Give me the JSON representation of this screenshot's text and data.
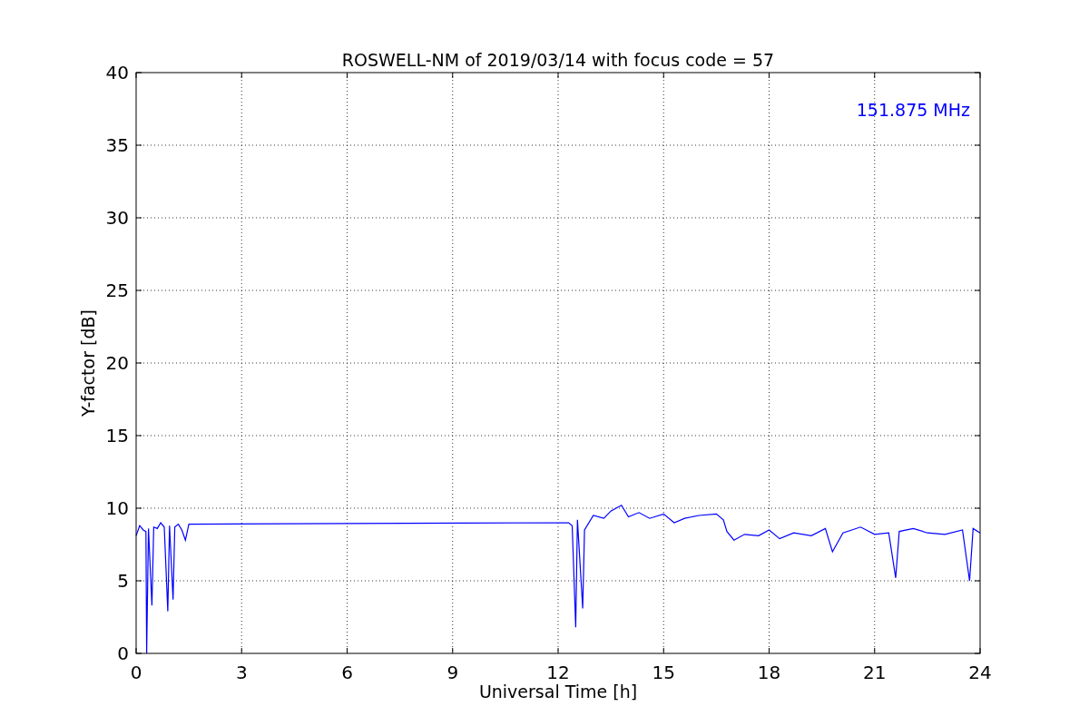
{
  "chart": {
    "chart_data": {
      "type": "line",
      "title": "ROSWELL-NM of 2019/03/14 with focus code = 57",
      "xlabel": "Universal Time [h]",
      "ylabel": "Y-factor [dB]",
      "x": [
        0,
        0.1,
        0.2,
        0.28,
        0.3,
        0.35,
        0.45,
        0.5,
        0.6,
        0.7,
        0.8,
        0.9,
        0.95,
        1.05,
        1.1,
        1.2,
        1.3,
        1.4,
        1.5,
        12.3,
        12.4,
        12.5,
        12.55,
        12.7,
        12.75,
        13,
        13.3,
        13.5,
        13.8,
        14,
        14.3,
        14.6,
        15,
        15.3,
        15.6,
        16,
        16.5,
        16.7,
        16.8,
        17,
        17.3,
        17.7,
        18,
        18.3,
        18.7,
        19.2,
        19.6,
        19.8,
        20.1,
        20.6,
        21,
        21.4,
        21.6,
        21.7,
        22.1,
        22.5,
        23,
        23.5,
        23.7,
        23.8,
        24
      ],
      "series": [
        {
          "color": "#0000ff",
          "values": [
            8.1,
            8.8,
            8.5,
            8.4,
            0,
            8.6,
            3.3,
            8.7,
            8.6,
            9.0,
            8.7,
            2.9,
            8.8,
            3.7,
            8.7,
            8.9,
            8.5,
            7.8,
            8.9,
            9.0,
            8.8,
            1.8,
            9.2,
            3.1,
            8.5,
            9.5,
            9.3,
            9.8,
            10.2,
            9.4,
            9.7,
            9.3,
            9.6,
            9.0,
            9.3,
            9.5,
            9.6,
            9.2,
            8.4,
            7.8,
            8.2,
            8.1,
            8.5,
            7.9,
            8.3,
            8.1,
            8.6,
            7.0,
            8.3,
            8.7,
            8.2,
            8.3,
            5.2,
            8.4,
            8.6,
            8.3,
            8.2,
            8.5,
            5.0,
            8.6,
            8.3
          ]
        }
      ],
      "xlim": [
        0,
        24
      ],
      "ylim": [
        0,
        40
      ],
      "xticks": [
        0,
        3,
        6,
        9,
        12,
        15,
        18,
        21,
        24
      ],
      "yticks": [
        0,
        5,
        10,
        15,
        20,
        25,
        30,
        35,
        40
      ],
      "grid": true,
      "annotations": [
        "151.875 MHz"
      ]
    }
  }
}
